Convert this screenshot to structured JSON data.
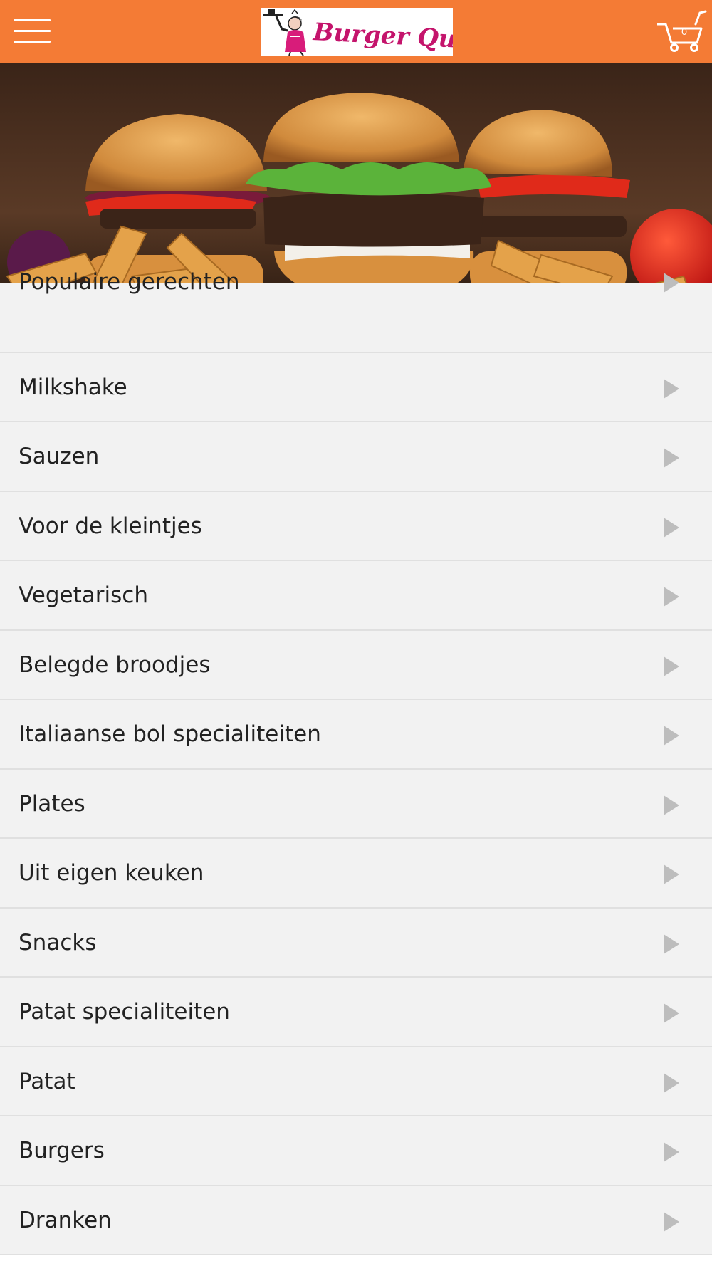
{
  "header": {
    "brand": "Burger Queen",
    "cart_count": "0",
    "colors": {
      "bar": "#f47b35",
      "brand_text": "#c4146c"
    },
    "icons": [
      "hamburger-menu-icon",
      "cart-icon"
    ]
  },
  "categories": [
    "Populaire gerechten",
    "Milkshake",
    "Sauzen",
    "Voor de kleintjes",
    "Vegetarisch",
    "Belegde broodjes",
    "Italiaanse bol specialiteiten",
    "Plates",
    "Uit eigen keuken",
    "Snacks",
    "Patat specialiteiten",
    "Patat",
    "Burgers",
    "Dranken"
  ]
}
